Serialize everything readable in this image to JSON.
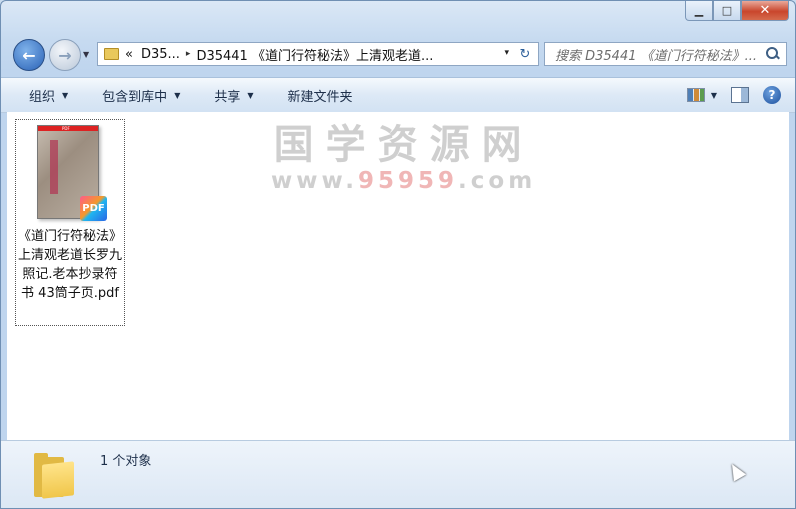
{
  "window": {
    "minimize_glyph": "▁",
    "maximize_glyph": "□",
    "close_glyph": "✕"
  },
  "navigation": {
    "back_glyph": "←",
    "forward_glyph": "→",
    "history_glyph": "▼"
  },
  "address_bar": {
    "overflow": "«",
    "segment_1": "D35...",
    "separator": "▸",
    "segment_2": "D35441 《道门行符秘法》上清观老道...",
    "dropdown_glyph": "▾",
    "refresh_glyph": "↻"
  },
  "search": {
    "placeholder": "搜索 D35441 《道门行符秘法》..."
  },
  "toolbar": {
    "organize": "组织",
    "include_library": "包含到库中",
    "share": "共享",
    "new_folder": "新建文件夹",
    "caret": "▼",
    "help": "?"
  },
  "files": [
    {
      "name": "《道门行符秘法》上清观老道长罗九照记.老本抄录符书 43筒子页.pdf",
      "thumb_label": "PDF",
      "badge": "PDF"
    }
  ],
  "watermark": {
    "line1": "国学资源网",
    "line2_prefix": "www.",
    "line2_red": "95959",
    "line2_suffix": ".com"
  },
  "status": {
    "item_count": "1 个对象"
  },
  "colors": {
    "frame": "#bfd5ee",
    "close_button": "#c9462c",
    "toolbar_text": "#1d2f4a"
  }
}
